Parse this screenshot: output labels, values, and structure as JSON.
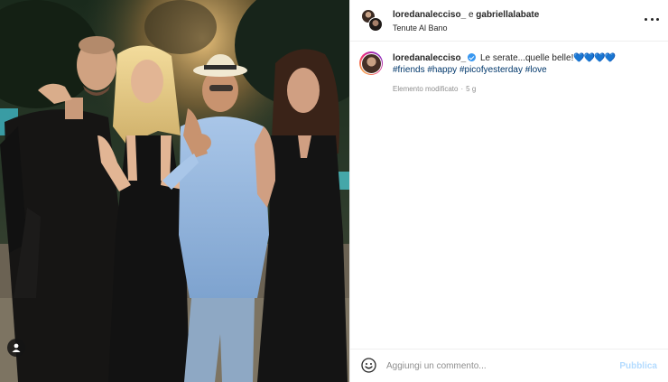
{
  "header": {
    "user1": "loredanalecciso_",
    "conjunction": "e",
    "user2": "gabriellalabate",
    "location": "Tenute Al Bano",
    "more_icon": "more-horizontal-icon"
  },
  "photo": {
    "alt_icon": "user-tag-icon"
  },
  "caption": {
    "username": "loredanalecciso_",
    "verified_icon": "verified-badge-icon",
    "text": "Le serate...quelle belle!",
    "hearts": "💙💙💙💙",
    "tags": [
      "#friends",
      "#happy",
      "#picofyesterday",
      "#love"
    ],
    "edited_label": "Elemento modificato",
    "separator": "·",
    "time_ago": "5 g"
  },
  "comment": {
    "emoji_icon": "emoji-smile-icon",
    "placeholder": "Aggiungi un commento...",
    "publish_label": "Pubblica"
  },
  "colors": {
    "hashtag": "#00376b",
    "publish_disabled": "#b3dbff",
    "verified": "#3897f0"
  }
}
